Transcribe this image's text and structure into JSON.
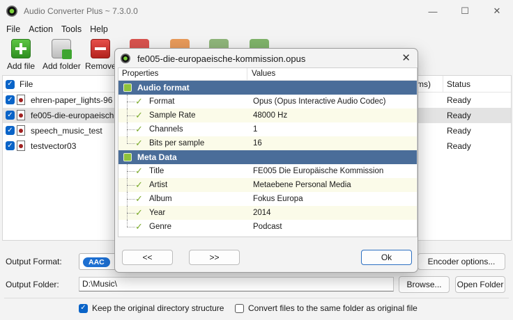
{
  "window": {
    "title": "Audio Converter Plus ~ 7.3.0.0",
    "controls": [
      "—",
      "☐",
      "✕"
    ]
  },
  "menu": [
    "File",
    "Action",
    "Tools",
    "Help"
  ],
  "toolbar": {
    "add_file": "Add file",
    "add_folder": "Add folder",
    "remove": "Remove"
  },
  "file_list": {
    "header_file": "File",
    "header_ms": "ms)",
    "header_status": "Status",
    "rows": [
      {
        "name": "ehren-paper_lights-96",
        "status": "Ready"
      },
      {
        "name": "fe005-die-europaeische-k",
        "status": "Ready"
      },
      {
        "name": "speech_music_test",
        "status": "Ready"
      },
      {
        "name": "testvector03",
        "status": "Ready"
      }
    ]
  },
  "bottom": {
    "output_format_label": "Output Format:",
    "output_format_value": "AAC",
    "encoder_options": "Encoder options...",
    "output_folder_label": "Output Folder:",
    "output_folder_value": "D:\\Music\\",
    "browse": "Browse...",
    "open_folder": "Open Folder",
    "keep_structure": "Keep the original directory structure",
    "same_folder": "Convert files to the same folder as original file"
  },
  "dialog": {
    "title": "fe005-die-europaeische-kommission.opus",
    "close": "✕",
    "col_properties": "Properties",
    "col_values": "Values",
    "audio_format": {
      "label": "Audio format",
      "props": [
        {
          "name": "Format",
          "value": "Opus (Opus Interactive Audio Codec)"
        },
        {
          "name": "Sample Rate",
          "value": "48000 Hz"
        },
        {
          "name": "Channels",
          "value": "1"
        },
        {
          "name": "Bits per sample",
          "value": "16"
        }
      ]
    },
    "meta_data": {
      "label": "Meta Data",
      "props": [
        {
          "name": "Title",
          "value": "FE005 Die Europäische Kommission"
        },
        {
          "name": "Artist",
          "value": "Metaebene Personal Media"
        },
        {
          "name": "Album",
          "value": "Fokus Europa"
        },
        {
          "name": "Year",
          "value": "2014"
        },
        {
          "name": "Genre",
          "value": "Podcast"
        }
      ]
    },
    "prev": "<<",
    "next": ">>",
    "ok": "Ok"
  },
  "colors": {
    "category_bg": "#4a6d99",
    "accent": "#0a64c8",
    "alt_row": "#fbfbe9",
    "tick": "#7aa92a"
  }
}
